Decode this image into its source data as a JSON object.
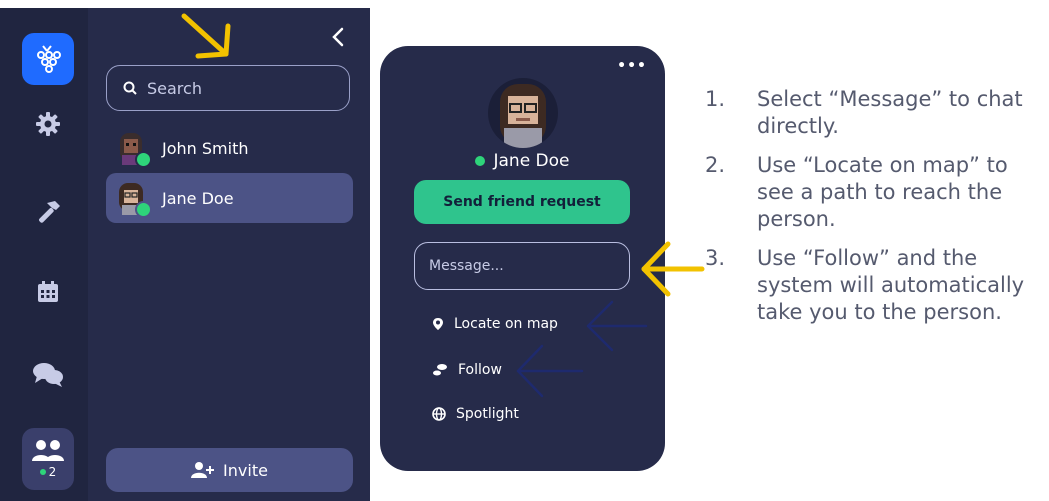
{
  "sidebar": {
    "people_count": "2",
    "icons": [
      "app-logo-icon",
      "settings-gear-icon",
      "build-hammer-icon",
      "calendar-icon",
      "chat-bubbles-icon",
      "people-icon"
    ]
  },
  "friends_panel": {
    "search_placeholder": "Search",
    "friends": [
      {
        "name": "John Smith",
        "status": "online"
      },
      {
        "name": "Jane Doe",
        "status": "online",
        "selected": true
      }
    ],
    "invite_label": "Invite"
  },
  "profile": {
    "name": "Jane Doe",
    "friend_request_label": "Send friend request",
    "message_placeholder": "Message...",
    "actions": [
      {
        "label": "Locate on map",
        "icon": "map-pin-icon"
      },
      {
        "label": "Follow",
        "icon": "footprints-icon"
      },
      {
        "label": "Spotlight",
        "icon": "globe-icon"
      }
    ]
  },
  "instructions": [
    {
      "num": "1.",
      "text": "Select “Message” to chat directly."
    },
    {
      "num": "2.",
      "text": "Use “Locate on map” to see a path to reach the person."
    },
    {
      "num": "3.",
      "text": "Use “Follow” and the system will automatically take you to the person."
    }
  ],
  "colors": {
    "accent_green": "#2fc48d",
    "online": "#2ed47a",
    "arrow_yellow": "#f2c200",
    "arrow_navy": "#1e2a6e"
  }
}
